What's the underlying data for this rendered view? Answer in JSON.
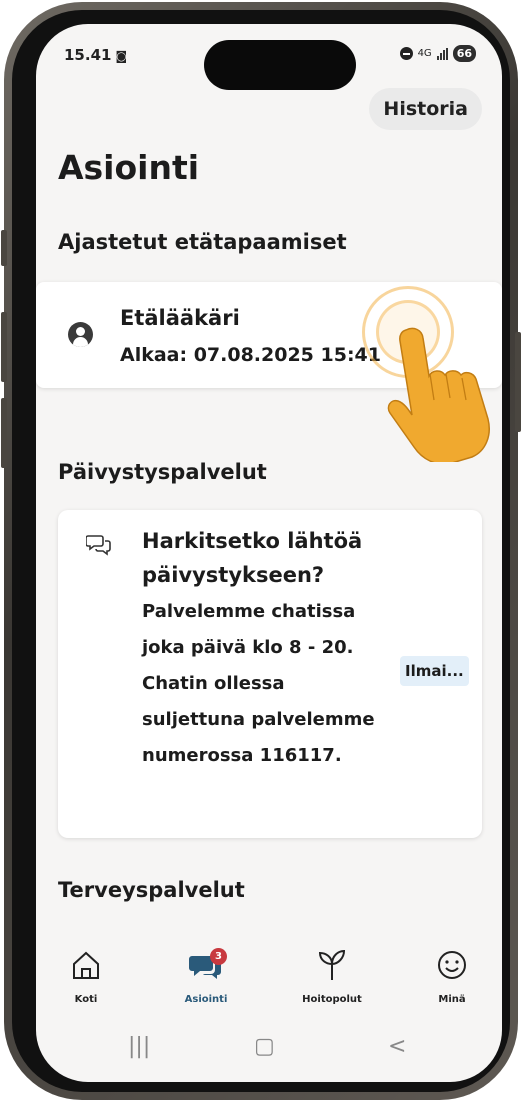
{
  "status_bar": {
    "time": "15.41",
    "network": "4G",
    "battery": "66"
  },
  "header": {
    "history_button": "Historia"
  },
  "page": {
    "title": "Asiointi"
  },
  "appointments": {
    "section_title": "Ajastetut etätapaamiset",
    "item": {
      "name": "Etälääkäri",
      "start": "Alkaa: 07.08.2025 15:41"
    }
  },
  "emergency": {
    "section_title": "Päivystyspalvelut",
    "card": {
      "title": "Harkitsetko lähtöä päivystykseen?",
      "body": "Palvelemme chatissa joka päivä klo 8 - 20. Chatin ollessa suljettuna palvelemme numerossa 116117.",
      "status_chip": "Ilmai..."
    }
  },
  "health_services": {
    "section_title": "Terveyspalvelut"
  },
  "bottom_nav": {
    "items": [
      {
        "label": "Koti",
        "icon": "home-icon"
      },
      {
        "label": "Asiointi",
        "icon": "chat-bubbles-icon",
        "badge": "3",
        "active": true
      },
      {
        "label": "Hoitopolut",
        "icon": "sprout-icon"
      },
      {
        "label": "Minä",
        "icon": "smiley-icon"
      }
    ]
  },
  "colors": {
    "badge": "#c8393f",
    "chip_bg": "#e3eff9",
    "tap_highlight": "#f3b24a",
    "active_nav": "#2a5a7a"
  }
}
